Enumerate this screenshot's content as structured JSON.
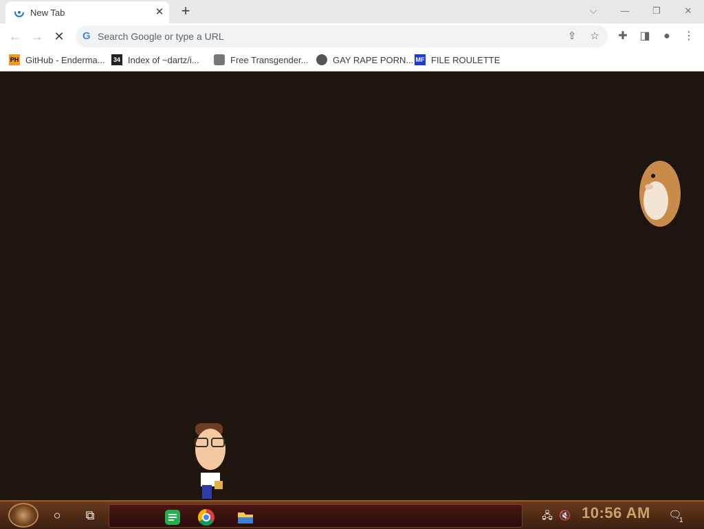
{
  "tab": {
    "title": "New Tab"
  },
  "omnibox": {
    "placeholder": "Search Google or type a URL"
  },
  "bookmarks": [
    {
      "label": "GitHub - Enderma...",
      "icon": "ph-icon",
      "badge": "PH"
    },
    {
      "label": "Index of ~dartz/i...",
      "icon": "grid-icon",
      "badge": "34"
    },
    {
      "label": "Free Transgender...",
      "icon": "stamp-icon",
      "badge": ""
    },
    {
      "label": "GAY RAPE PORN...",
      "icon": "globe-icon",
      "badge": ""
    },
    {
      "label": "FILE ROULETTE",
      "icon": "file-roulette-icon",
      "badge": "MF"
    }
  ],
  "taskbar": {
    "clock": "10:56 AM",
    "notification_count": "1"
  },
  "colors": {
    "page_bg": "#1f150f",
    "taskbar_bg": "#4a2614",
    "clock": "#c9a36a"
  }
}
